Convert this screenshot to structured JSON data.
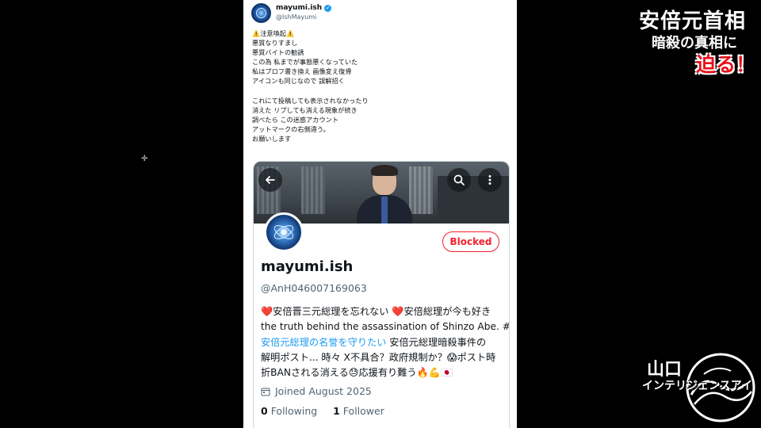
{
  "post": {
    "display_name": "mayumi.ish",
    "handle": "@IshMayumi",
    "lines": [
      "⚠️注意喚起⚠️",
      "悪質なりすまし",
      "悪質バイトの勧誘",
      "この為 私までが事態悪くなっていた",
      "私はプロフ書き換え 画像変え復帰",
      "アイコンも同じなので 誤解招く",
      "",
      "これにて投稿しても表示されなかったり",
      "消えた リプしても消える現象が続き",
      "調べたら この迷惑アカウント",
      "アットマークの右側違う。",
      "お願いします"
    ]
  },
  "profile": {
    "name": "mayumi.ish",
    "handle": "@AnH046007169063",
    "blocked_label": "Blocked",
    "bio_lines": [
      "❤️安倍晋三元総理を忘れない ❤️安倍総理が今も好き",
      "the truth behind the assassination of Shinzo Abe. #",
      "安倍元総理の名誉を守りたい",
      " 安倍元総理暗殺事件の",
      "解明ポスト... 時々 X不具合？政府規制か？😱ポスト時",
      "折BANされる消える😓応援有り難う🔥💪🇯🇵"
    ],
    "joined": "Joined August 2025",
    "following_count": "0",
    "following_label": "Following",
    "follower_count": "1",
    "follower_label": "Follower"
  },
  "overlay": {
    "title_line1": "安倍元首相",
    "title_line2": "暗殺の真相に",
    "title_line3": "迫る！",
    "logo_line1": "山口",
    "logo_line2": "インテリジェンスアイ"
  },
  "colors": {
    "blocked": "#f4212e",
    "link": "#1d9bf0",
    "title_accent": "#e8101a"
  }
}
